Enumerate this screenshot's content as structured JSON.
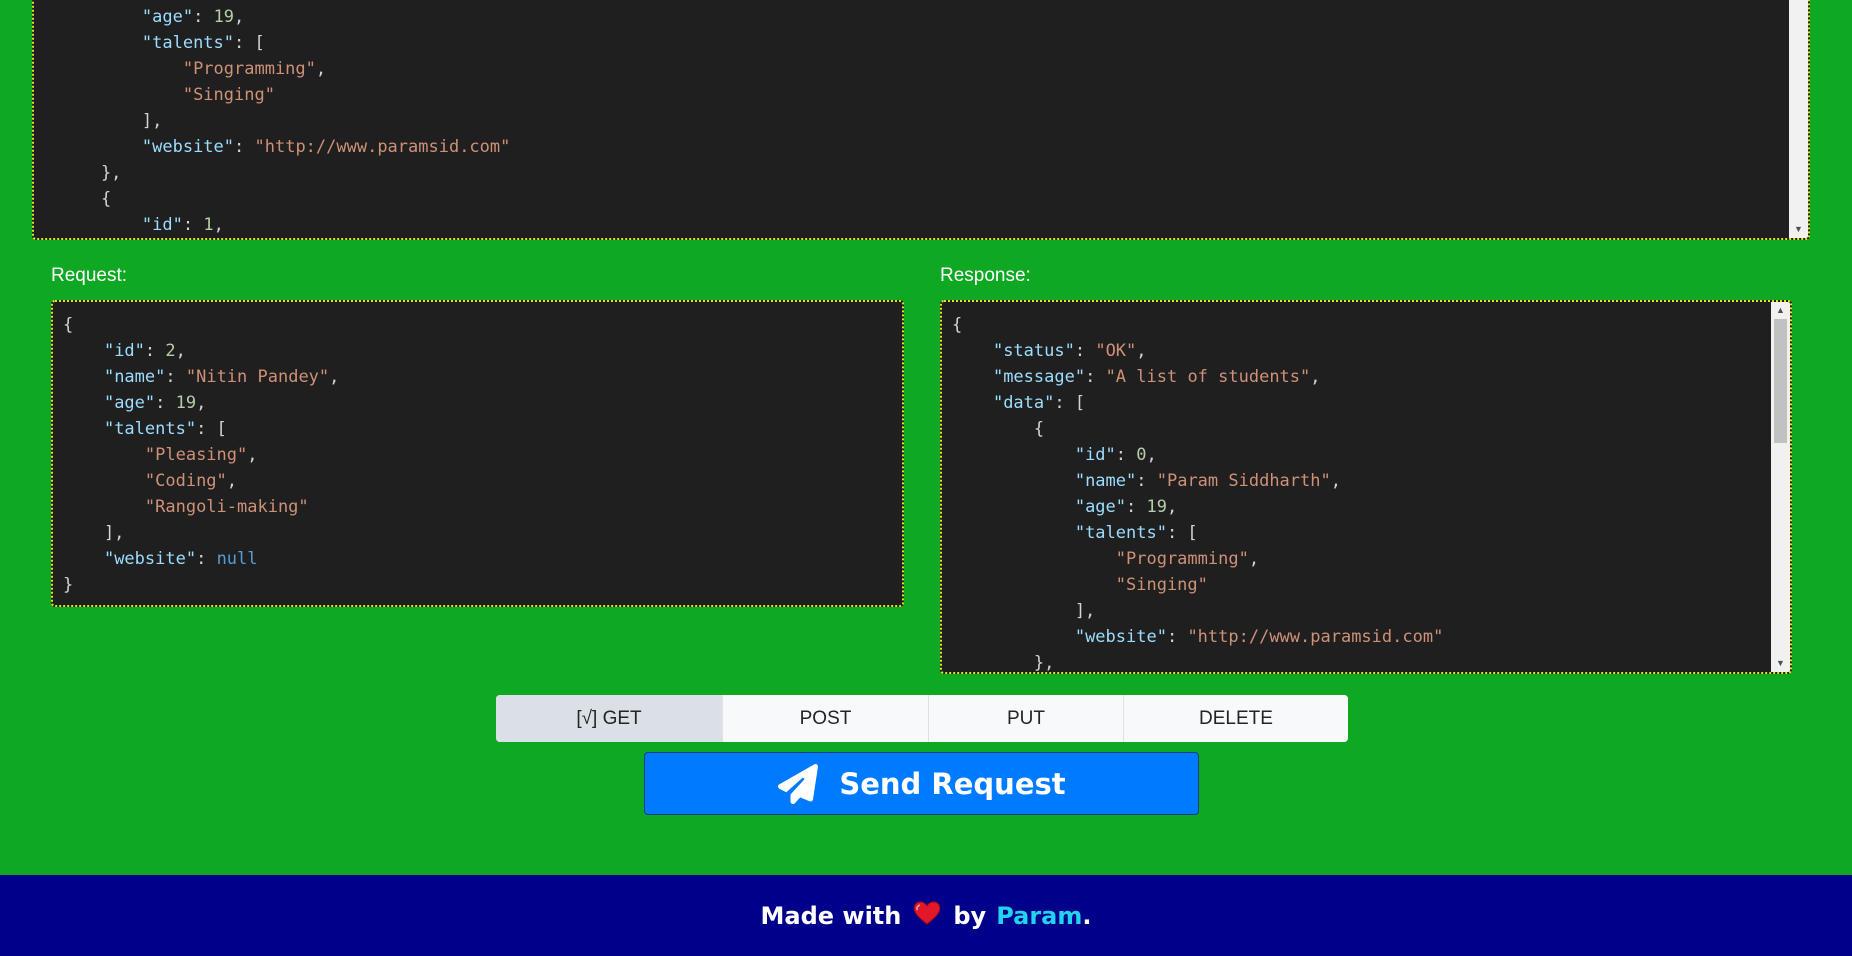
{
  "top_json_lines": [
    [
      [
        "p",
        "        },"
      ]
    ],
    [
      [
        "p",
        "        "
      ],
      [
        "k",
        "\"age\""
      ],
      [
        "p",
        ": "
      ],
      [
        "n",
        "19"
      ],
      [
        "p",
        ","
      ]
    ],
    [
      [
        "p",
        "        "
      ],
      [
        "k",
        "\"talents\""
      ],
      [
        "p",
        ": ["
      ]
    ],
    [
      [
        "p",
        "            "
      ],
      [
        "s",
        "\"Programming\""
      ],
      [
        "p",
        ","
      ]
    ],
    [
      [
        "p",
        "            "
      ],
      [
        "s",
        "\"Singing\""
      ]
    ],
    [
      [
        "p",
        "        ],"
      ]
    ],
    [
      [
        "p",
        "        "
      ],
      [
        "k",
        "\"website\""
      ],
      [
        "p",
        ": "
      ],
      [
        "s",
        "\"http://www.paramsid.com\""
      ]
    ],
    [
      [
        "p",
        "    },"
      ]
    ],
    [
      [
        "p",
        "    {"
      ]
    ],
    [
      [
        "p",
        "        "
      ],
      [
        "k",
        "\"id\""
      ],
      [
        "p",
        ": "
      ],
      [
        "n",
        "1"
      ],
      [
        "p",
        ","
      ]
    ]
  ],
  "request": {
    "label": "Request:",
    "lines": [
      [
        [
          "p",
          "{"
        ]
      ],
      [
        [
          "p",
          "    "
        ],
        [
          "k",
          "\"id\""
        ],
        [
          "p",
          ": "
        ],
        [
          "n",
          "2"
        ],
        [
          "p",
          ","
        ]
      ],
      [
        [
          "p",
          "    "
        ],
        [
          "k",
          "\"name\""
        ],
        [
          "p",
          ": "
        ],
        [
          "s",
          "\"Nitin Pandey\""
        ],
        [
          "p",
          ","
        ]
      ],
      [
        [
          "p",
          "    "
        ],
        [
          "k",
          "\"age\""
        ],
        [
          "p",
          ": "
        ],
        [
          "n",
          "19"
        ],
        [
          "p",
          ","
        ]
      ],
      [
        [
          "p",
          "    "
        ],
        [
          "k",
          "\"talents\""
        ],
        [
          "p",
          ": ["
        ]
      ],
      [
        [
          "p",
          "        "
        ],
        [
          "s",
          "\"Pleasing\""
        ],
        [
          "p",
          ","
        ]
      ],
      [
        [
          "p",
          "        "
        ],
        [
          "s",
          "\"Coding\""
        ],
        [
          "p",
          ","
        ]
      ],
      [
        [
          "p",
          "        "
        ],
        [
          "s",
          "\"Rangoli-making\""
        ]
      ],
      [
        [
          "p",
          "    ],"
        ]
      ],
      [
        [
          "p",
          "    "
        ],
        [
          "k",
          "\"website\""
        ],
        [
          "p",
          ": "
        ],
        [
          "kw",
          "null"
        ]
      ],
      [
        [
          "p",
          "}"
        ]
      ]
    ]
  },
  "response": {
    "label": "Response:",
    "scroll_fraction_visible": 0.37,
    "lines": [
      [
        [
          "p",
          "{"
        ]
      ],
      [
        [
          "p",
          "    "
        ],
        [
          "k",
          "\"status\""
        ],
        [
          "p",
          ": "
        ],
        [
          "s",
          "\"OK\""
        ],
        [
          "p",
          ","
        ]
      ],
      [
        [
          "p",
          "    "
        ],
        [
          "k",
          "\"message\""
        ],
        [
          "p",
          ": "
        ],
        [
          "s",
          "\"A list of students\""
        ],
        [
          "p",
          ","
        ]
      ],
      [
        [
          "p",
          "    "
        ],
        [
          "k",
          "\"data\""
        ],
        [
          "p",
          ": ["
        ]
      ],
      [
        [
          "p",
          "        {"
        ]
      ],
      [
        [
          "p",
          "            "
        ],
        [
          "k",
          "\"id\""
        ],
        [
          "p",
          ": "
        ],
        [
          "n",
          "0"
        ],
        [
          "p",
          ","
        ]
      ],
      [
        [
          "p",
          "            "
        ],
        [
          "k",
          "\"name\""
        ],
        [
          "p",
          ": "
        ],
        [
          "s",
          "\"Param Siddharth\""
        ],
        [
          "p",
          ","
        ]
      ],
      [
        [
          "p",
          "            "
        ],
        [
          "k",
          "\"age\""
        ],
        [
          "p",
          ": "
        ],
        [
          "n",
          "19"
        ],
        [
          "p",
          ","
        ]
      ],
      [
        [
          "p",
          "            "
        ],
        [
          "k",
          "\"talents\""
        ],
        [
          "p",
          ": ["
        ]
      ],
      [
        [
          "p",
          "                "
        ],
        [
          "s",
          "\"Programming\""
        ],
        [
          "p",
          ","
        ]
      ],
      [
        [
          "p",
          "                "
        ],
        [
          "s",
          "\"Singing\""
        ]
      ],
      [
        [
          "p",
          "            ],"
        ]
      ],
      [
        [
          "p",
          "            "
        ],
        [
          "k",
          "\"website\""
        ],
        [
          "p",
          ": "
        ],
        [
          "s",
          "\"http://www.paramsid.com\""
        ]
      ],
      [
        [
          "p",
          "        },"
        ]
      ]
    ]
  },
  "methods": [
    {
      "label": "[√] GET",
      "active": true
    },
    {
      "label": "POST",
      "active": false
    },
    {
      "label": "PUT",
      "active": false
    },
    {
      "label": "DELETE",
      "active": false
    }
  ],
  "send_button": {
    "label": "Send Request",
    "icon": "paper-plane-icon"
  },
  "footer": {
    "prefix": "Made with",
    "heart_icon": "heart-icon",
    "by": "by",
    "author": "Param",
    "suffix": "."
  },
  "colors": {
    "page_bg": "#0ea822",
    "code_bg": "#1f1f1f",
    "json_key": "#9cdcfe",
    "json_string": "#ce9178",
    "json_number": "#b5cea8",
    "json_keyword": "#569cd6",
    "send_button": "#007bff",
    "footer_bg": "#00008b",
    "author_link": "#22d3ee"
  }
}
